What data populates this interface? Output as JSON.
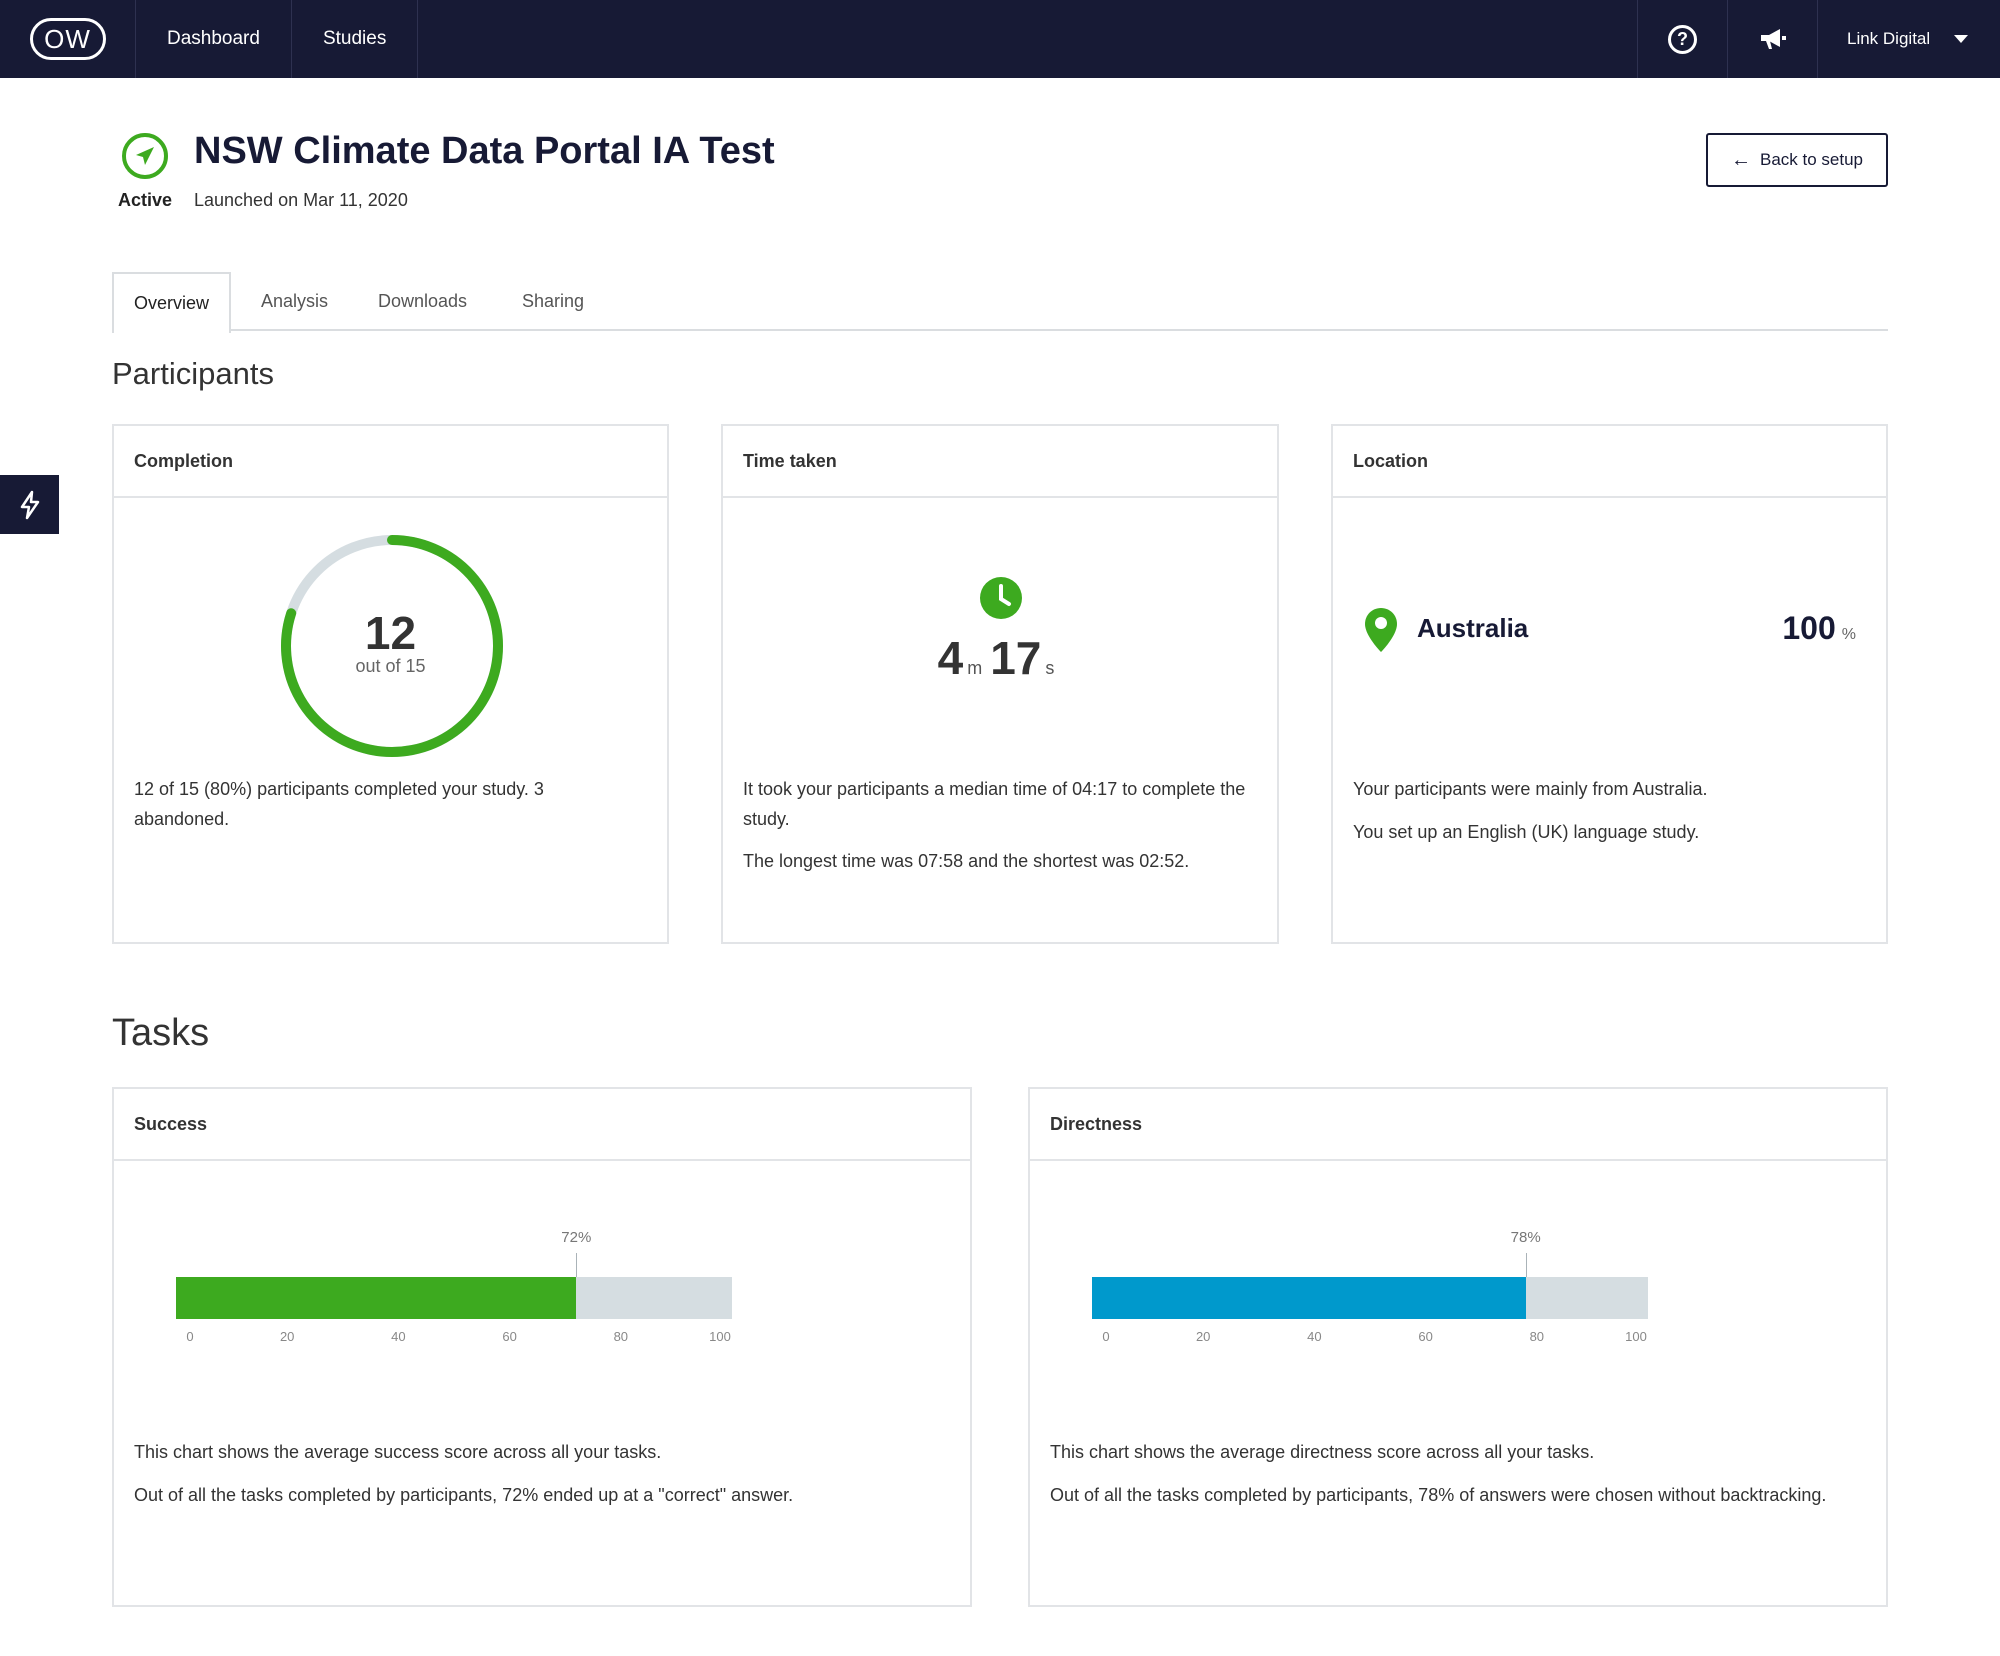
{
  "nav": {
    "logo": "OW",
    "items": [
      "Dashboard",
      "Studies"
    ],
    "account": "Link Digital"
  },
  "study": {
    "status": "Active",
    "title": "NSW Climate Data Portal IA Test",
    "launched": "Launched on Mar 11, 2020",
    "back_button": "Back to setup"
  },
  "tabs": [
    "Overview",
    "Analysis",
    "Downloads",
    "Sharing"
  ],
  "participants": {
    "section_title": "Participants",
    "completion": {
      "title": "Completion",
      "completed": 12,
      "completed_label": "12",
      "total": 15,
      "out_of": "out of 15",
      "text": "12 of 15 (80%) participants completed your study. 3 abandoned."
    },
    "time": {
      "title": "Time taken",
      "minutes": "4",
      "minutes_unit": "m",
      "seconds": "17",
      "seconds_unit": "s",
      "text1": "It took your participants a median time of 04:17 to complete the study.",
      "text2": "The longest time was 07:58 and the shortest was 02:52."
    },
    "location": {
      "title": "Location",
      "country": "Australia",
      "percent": "100",
      "percent_unit": "%",
      "text1": "Your participants were mainly from Australia.",
      "text2": "You set up an English (UK) language study."
    }
  },
  "tasks": {
    "section_title": "Tasks",
    "success": {
      "title": "Success",
      "value": 72,
      "value_label": "72%",
      "ticks": [
        "0",
        "20",
        "40",
        "60",
        "80",
        "100"
      ],
      "color": "#3daa1f",
      "text1": "This chart shows the average success score across all your tasks.",
      "text2": "Out of all the tasks completed by participants, 72% ended up at a \"correct\" answer."
    },
    "directness": {
      "title": "Directness",
      "value": 78,
      "value_label": "78%",
      "ticks": [
        "0",
        "20",
        "40",
        "60",
        "80",
        "100"
      ],
      "color": "#0099cc",
      "text1": "This chart shows the average directness score across all your tasks.",
      "text2": "Out of all the tasks completed by participants, 78% of answers were chosen without backtracking."
    }
  },
  "colors": {
    "nav_bg": "#171a35",
    "accent_green": "#3daa1f",
    "accent_blue": "#0099cc"
  }
}
